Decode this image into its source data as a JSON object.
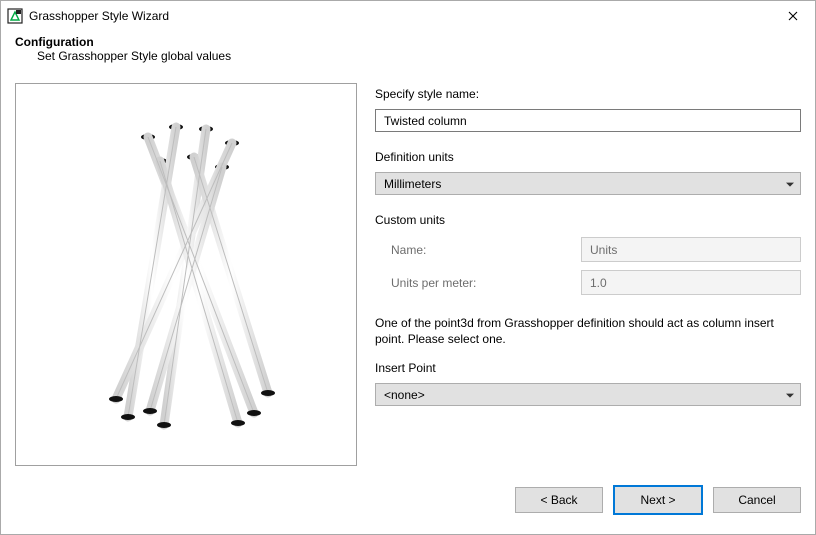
{
  "window": {
    "title": "Grasshopper Style Wizard"
  },
  "header": {
    "title": "Configuration",
    "subtitle": "Set Grasshopper Style global values"
  },
  "form": {
    "style_name_label": "Specify style name:",
    "style_name_value": "Twisted column",
    "definition_units_label": "Definition units",
    "definition_units_value": "Millimeters",
    "custom_units_title": "Custom units",
    "custom_units_name_label": "Name:",
    "custom_units_name_value": "Units",
    "custom_units_upm_label": "Units per meter:",
    "custom_units_upm_value": "1.0",
    "help_text": "One of the point3d from Grasshopper definition should act as column insert point. Please select one.",
    "insert_point_label": "Insert Point",
    "insert_point_value": "<none>"
  },
  "buttons": {
    "back": "< Back",
    "next": "Next >",
    "cancel": "Cancel"
  }
}
